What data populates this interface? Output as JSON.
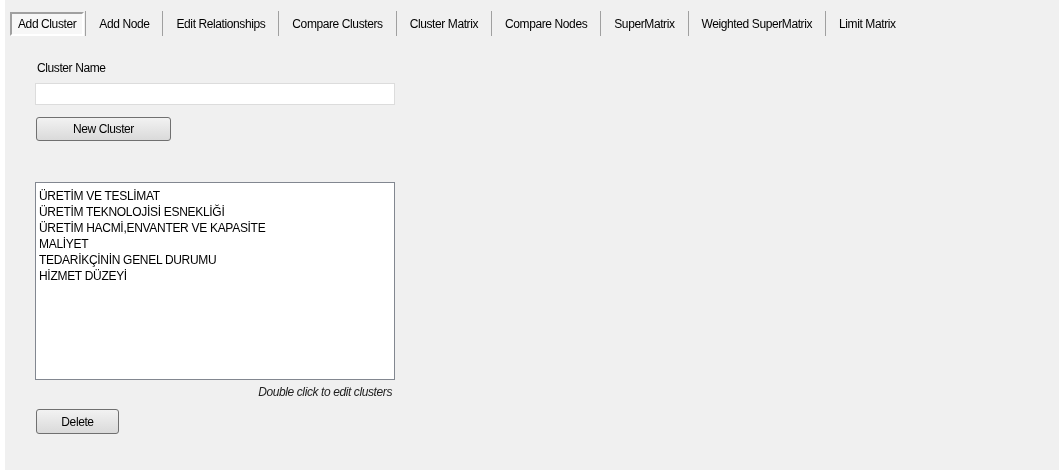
{
  "tabs": [
    {
      "label": "Add Cluster",
      "selected": true
    },
    {
      "label": "Add Node",
      "selected": false
    },
    {
      "label": "Edit Relationships",
      "selected": false
    },
    {
      "label": "Compare Clusters",
      "selected": false
    },
    {
      "label": "Cluster Matrix",
      "selected": false
    },
    {
      "label": "Compare Nodes",
      "selected": false
    },
    {
      "label": "SuperMatrix",
      "selected": false
    },
    {
      "label": "Weighted SuperMatrix",
      "selected": false
    },
    {
      "label": "Limit Matrix",
      "selected": false
    }
  ],
  "cluster_name": {
    "label": "Cluster Name"
  },
  "new_cluster_button": "New Cluster",
  "clusters": [
    "ÜRETİM VE TESLİMAT",
    "ÜRETİM TEKNOLOJİSİ ESNEKLİĞİ",
    "ÜRETİM HACMİ,ENVANTER VE KAPASİTE",
    "MALİYET",
    "TEDARİKÇİNİN GENEL DURUMU",
    "HİZMET DÜZEYİ"
  ],
  "hint": "Double click to edit clusters",
  "delete_button": "Delete"
}
